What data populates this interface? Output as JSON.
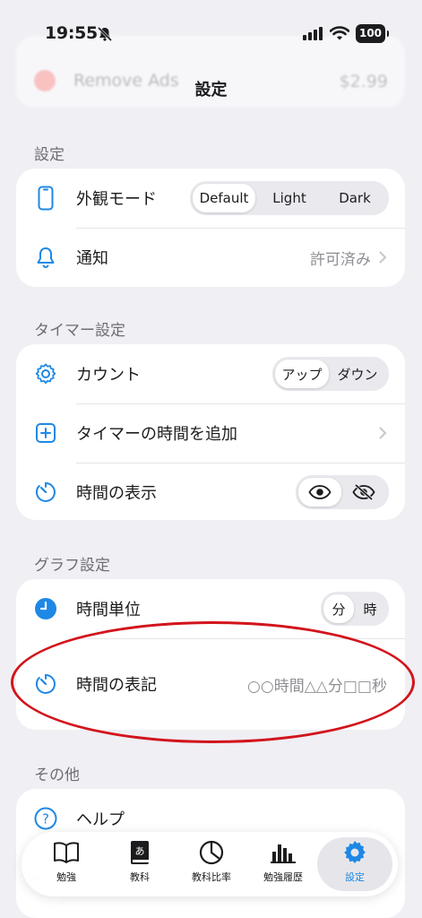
{
  "status_bar": {
    "time": "19:55",
    "battery": "100"
  },
  "background_header": {
    "item_label": "Remove Ads",
    "price": "$2.99"
  },
  "nav": {
    "title": "設定"
  },
  "sections": {
    "settings": {
      "header": "設定",
      "appearance": {
        "label": "外観モード",
        "options": [
          "Default",
          "Light",
          "Dark"
        ],
        "selected": "Default"
      },
      "notification": {
        "label": "通知",
        "value": "許可済み"
      }
    },
    "timer": {
      "header": "タイマー設定",
      "count": {
        "label": "カウント",
        "options": [
          "アップ",
          "ダウン"
        ],
        "selected": "アップ"
      },
      "add_time": {
        "label": "タイマーの時間を追加"
      },
      "show_time": {
        "label": "時間の表示",
        "selected": "eye-icon"
      }
    },
    "graph": {
      "header": "グラフ設定",
      "time_unit": {
        "label": "時間単位",
        "options": [
          "分",
          "時"
        ],
        "selected": "分"
      },
      "time_format": {
        "label": "時間の表記",
        "value": "○○時間△△分□□秒"
      }
    },
    "other": {
      "header": "その他",
      "help": {
        "label": "ヘルプ"
      }
    }
  },
  "tabbar": {
    "tabs": [
      {
        "label": "勉強",
        "icon": "book-icon"
      },
      {
        "label": "教科",
        "icon": "textbook-icon"
      },
      {
        "label": "教科比率",
        "icon": "pie-chart-icon"
      },
      {
        "label": "勉強履歴",
        "icon": "bar-chart-icon"
      },
      {
        "label": "設定",
        "icon": "gear-icon",
        "active": true
      }
    ]
  },
  "colors": {
    "accent": "#1e88e5",
    "annotation": "#d2141c",
    "background": "#efeff4"
  }
}
